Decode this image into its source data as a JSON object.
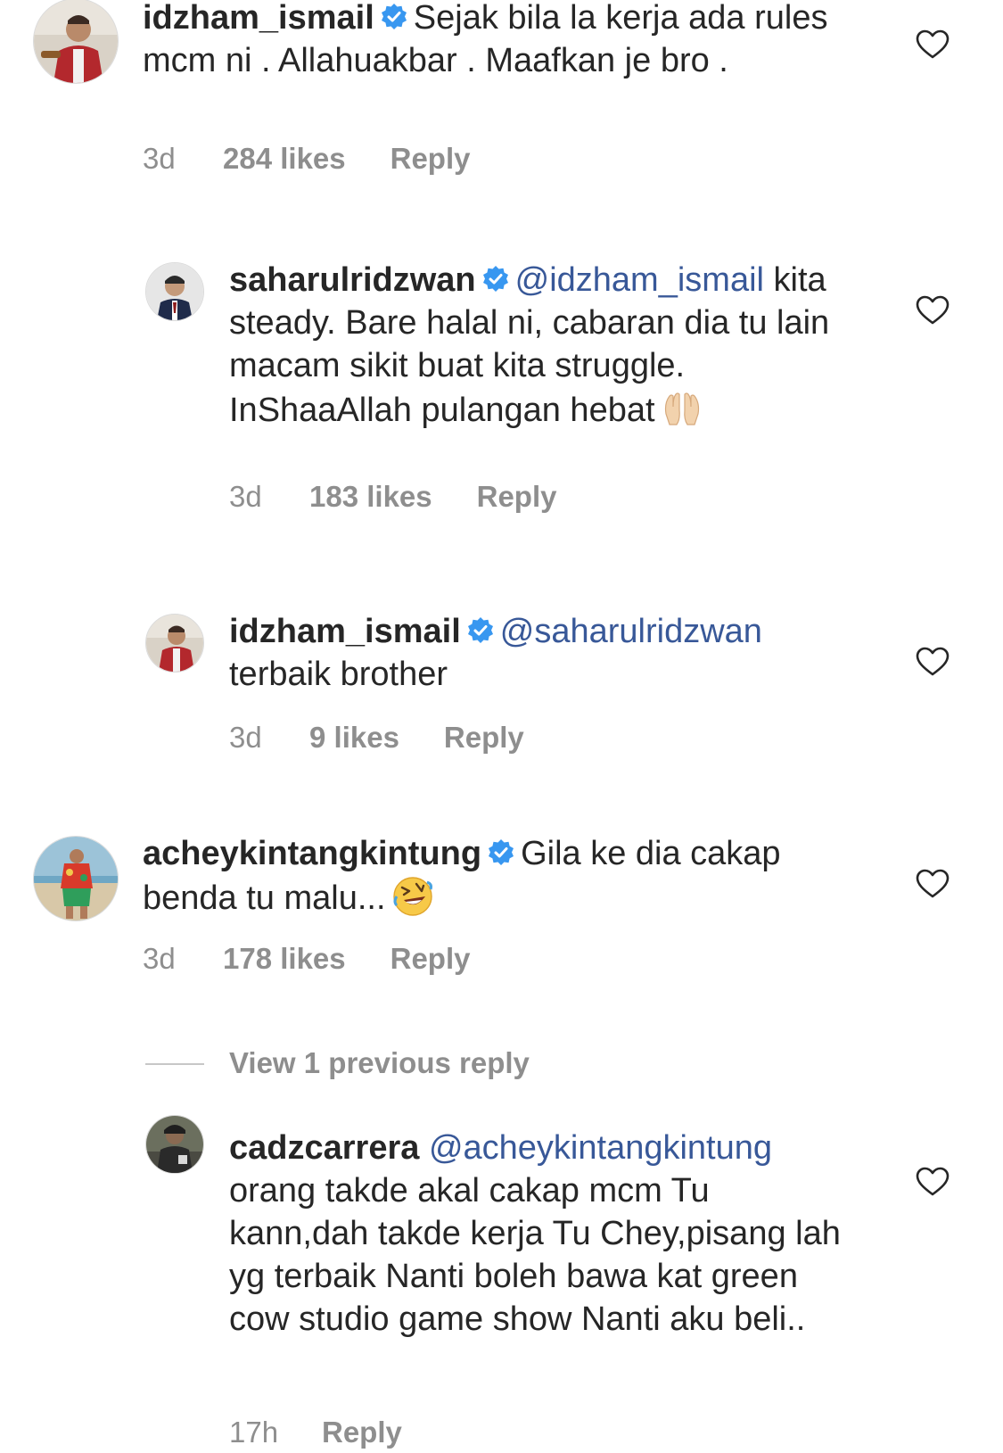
{
  "colors": {
    "mention": "#385898",
    "meta": "#8e8e8e",
    "verified": "#3897f0",
    "text": "#262626"
  },
  "icons": {
    "verified": "verified-badge-icon",
    "heart": "heart-outline-icon"
  },
  "comments": [
    {
      "username": "idzham_ismail",
      "verified": true,
      "mention": "",
      "text": "Sejak bila la kerja ada rules mcm ni . Allahuakbar . Maafkan je bro .",
      "emoji": "",
      "time": "3d",
      "likes": "284 likes",
      "reply": "Reply"
    },
    {
      "username": "saharulridzwan",
      "verified": true,
      "mention": "@idzham_ismail",
      "text": "kita steady. Bare halal ni, cabaran dia tu lain macam sikit buat kita struggle. InShaaAllah pulangan hebat",
      "emoji": "raised-hands-emoji",
      "time": "3d",
      "likes": "183 likes",
      "reply": "Reply"
    },
    {
      "username": "idzham_ismail",
      "verified": true,
      "mention": "@saharulridzwan",
      "text": "terbaik brother",
      "emoji": "",
      "time": "3d",
      "likes": "9 likes",
      "reply": "Reply"
    },
    {
      "username": "acheykintangkintung",
      "verified": true,
      "mention": "",
      "text": "Gila ke dia cakap benda tu malu...",
      "emoji": "rofl-emoji",
      "time": "3d",
      "likes": "178 likes",
      "reply": "Reply"
    },
    {
      "username": "cadzcarrera",
      "verified": false,
      "mention": "@acheykintangkintung",
      "text": "orang takde akal cakap mcm Tu kann,dah takde kerja Tu Chey,pisang lah yg terbaik Nanti boleh bawa kat green cow studio game show Nanti aku beli..",
      "emoji": "",
      "time": "17h",
      "likes": "",
      "reply": "Reply"
    }
  ],
  "view_previous": "View 1 previous reply"
}
